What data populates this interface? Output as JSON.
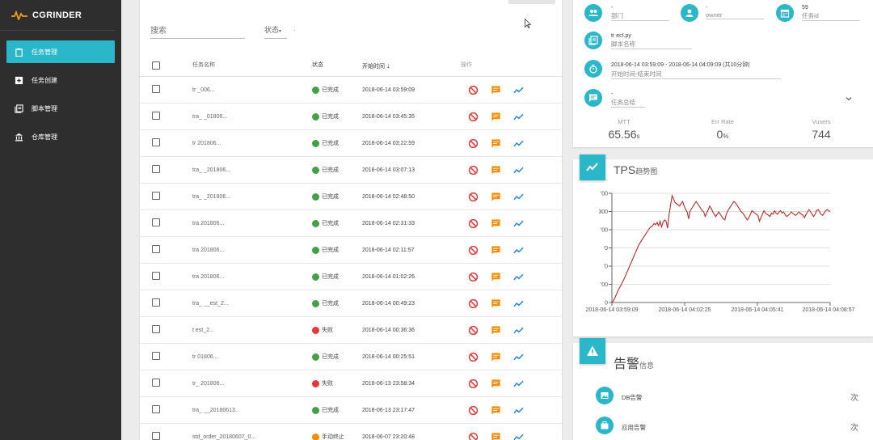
{
  "brand": {
    "name": "CGRINDER"
  },
  "nav": [
    {
      "label": "任务管理",
      "icon": "clipboard-icon",
      "active": true
    },
    {
      "label": "任务创建",
      "icon": "plus-box-icon",
      "active": false
    },
    {
      "label": "脚本管理",
      "icon": "book-icon",
      "active": false
    },
    {
      "label": "仓库管理",
      "icon": "bank-icon",
      "active": false
    }
  ],
  "filters": {
    "search_placeholder": "搜索",
    "status_label": "状态",
    "status_caret": "▾",
    "status_value": "·"
  },
  "table": {
    "headers": {
      "name": "任务名称",
      "status": "状态",
      "time": "开始时间",
      "time_sort": "↓",
      "ops": "操作"
    },
    "rows": [
      {
        "name": "tr            _006...",
        "status": "已完成",
        "status_color": "#43a047",
        "time": "2018-06-14 03:59:09"
      },
      {
        "name": "tra_         _01806...",
        "status": "已完成",
        "status_color": "#43a047",
        "time": "2018-06-14 03:45:35"
      },
      {
        "name": "tr            201806...",
        "status": "已完成",
        "status_color": "#43a047",
        "time": "2018-06-14 03:22:59"
      },
      {
        "name": "tra_         _201806...",
        "status": "已完成",
        "status_color": "#43a047",
        "time": "2018-06-14 03:07:13"
      },
      {
        "name": "tra_         _201806...",
        "status": "已完成",
        "status_color": "#43a047",
        "time": "2018-06-14 02:48:50"
      },
      {
        "name": "tra           201806...",
        "status": "已完成",
        "status_color": "#43a047",
        "time": "2018-06-14 02:31:33"
      },
      {
        "name": "tra           201806...",
        "status": "已完成",
        "status_color": "#43a047",
        "time": "2018-06-14 02:11:57"
      },
      {
        "name": "tra           201806...",
        "status": "已完成",
        "status_color": "#43a047",
        "time": "2018-06-14 01:02:26"
      },
      {
        "name": "tra_       __est_2...",
        "status": "已完成",
        "status_color": "#43a047",
        "time": "2018-06-14 00:49:23"
      },
      {
        "name": "t             est_2...",
        "status": "失败",
        "status_color": "#e53935",
        "time": "2018-06-14 00:36:36"
      },
      {
        "name": "tr             01806...",
        "status": "已完成",
        "status_color": "#43a047",
        "time": "2018-06-14 00:25:51"
      },
      {
        "name": "tr_           201806...",
        "status": "失败",
        "status_color": "#e53935",
        "time": "2018-06-13 23:58:34"
      },
      {
        "name": "tra_       __20180613...",
        "status": "已完成",
        "status_color": "#43a047",
        "time": "2018-06-13 23:17:47"
      },
      {
        "name": "std_order_20180607_0...",
        "status": "手动终止",
        "status_color": "#fb8c00",
        "time": "2018-06-07 23:20:48"
      }
    ]
  },
  "info": {
    "dept_value": "-",
    "dept_label": "部门",
    "owner_value": "-",
    "owner_label": "owner",
    "taskid_value": "59",
    "taskid_label": "任务id",
    "script_value": "tr           ect.py",
    "script_label": "脚本名称",
    "time_value": "2018-06-14 03:59:09 - 2018-06-14 04:09:09 (共10分钟)",
    "time_label": "开始时间-结束时间",
    "summary_value": "-",
    "summary_label": "任务总结",
    "metrics": [
      {
        "label": "MTT",
        "value": "65.56",
        "unit": "s"
      },
      {
        "label": "Err Rate",
        "value": "0",
        "unit": "%"
      },
      {
        "label": "Vusers",
        "value": "744",
        "unit": ""
      }
    ]
  },
  "tps": {
    "title": "TPS",
    "subtitle": "趋势图",
    "chart_data": {
      "type": "line",
      "x_tick_labels": [
        "2018-06-14 03:59:09",
        "2018-06-14 04:02:25",
        "2018-06-14 04:05:41",
        "2018-06-14 04:08:57"
      ],
      "y_tick_labels": [
        "0",
        "'00",
        "'0",
        "'0",
        "'00",
        "300",
        "'00"
      ],
      "color": "#c62828",
      "series": [
        {
          "values": [
            0,
            15,
            40,
            70,
            100,
            125,
            150,
            175,
            200,
            230,
            260,
            290,
            320,
            350,
            380,
            410,
            440,
            470,
            500,
            520,
            540,
            560,
            580,
            600,
            620,
            640,
            650,
            660,
            680,
            670,
            690,
            660,
            700,
            650,
            690,
            710,
            700,
            640,
            760,
            840,
            920,
            890,
            860,
            850,
            840,
            830,
            855,
            870,
            830,
            800,
            780,
            720,
            790,
            810,
            830,
            850,
            870,
            850,
            830,
            810,
            790,
            780,
            740,
            770,
            800,
            830,
            810,
            780,
            760,
            740,
            760,
            780,
            760,
            740,
            720,
            710,
            760,
            790,
            810,
            830,
            850,
            870,
            860,
            840,
            820,
            800,
            780,
            770,
            750,
            730,
            710,
            730,
            760,
            790,
            780,
            770,
            760,
            750,
            700,
            730,
            760,
            790,
            770,
            760,
            750,
            740,
            770,
            760,
            790,
            770,
            760,
            780,
            790,
            770,
            780,
            760,
            740,
            750,
            760,
            780,
            770,
            760,
            750,
            760,
            780,
            770,
            760,
            750,
            730,
            760,
            780,
            800,
            780,
            760,
            740,
            760,
            790,
            800,
            780,
            760,
            750,
            770,
            790,
            800,
            790,
            780
          ]
        }
      ]
    }
  },
  "alerts": {
    "title": "告警",
    "subtitle": "信息",
    "items": [
      {
        "label": "DB告警",
        "count": "次",
        "icon": "image-icon"
      },
      {
        "label": "应用告警",
        "count": "次",
        "icon": "briefcase-icon"
      }
    ]
  }
}
